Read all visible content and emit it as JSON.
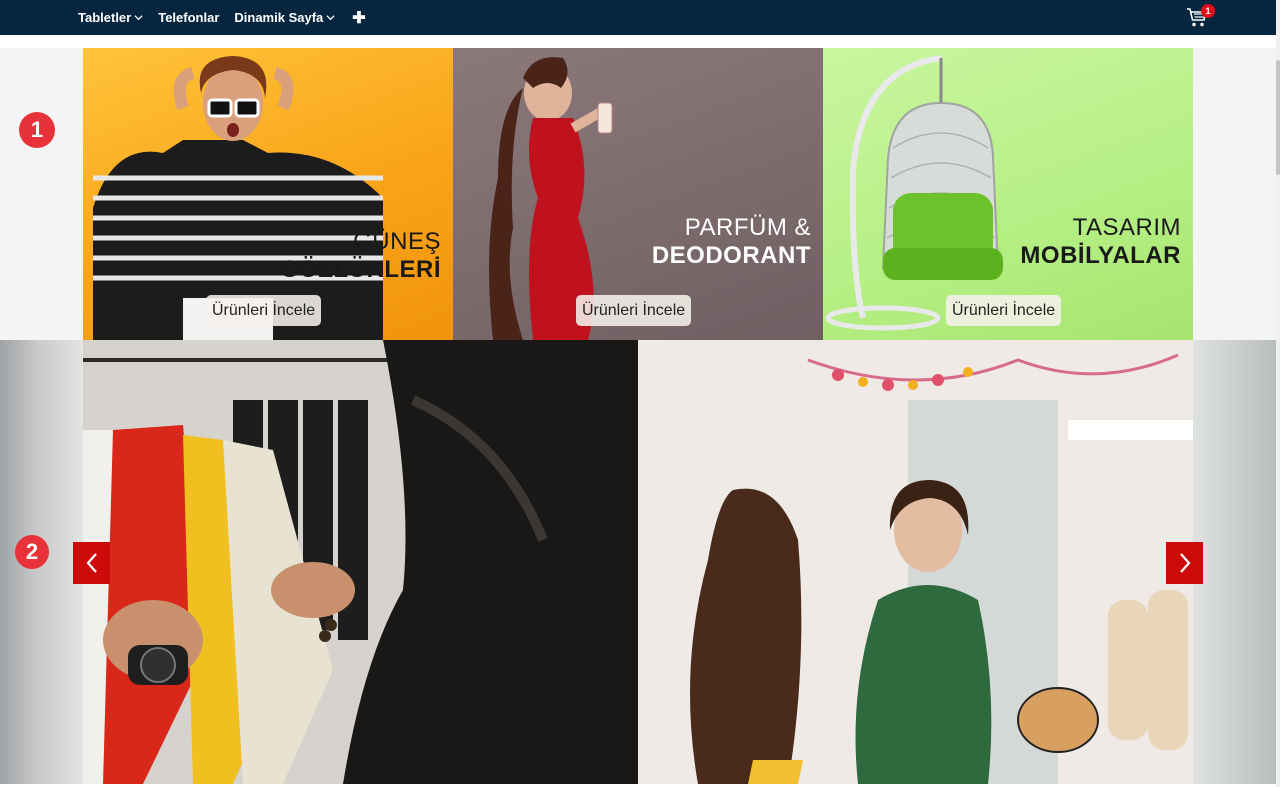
{
  "nav": {
    "items": [
      {
        "label": "Tabletler",
        "has_dropdown": true
      },
      {
        "label": "Telefonlar",
        "has_dropdown": false
      },
      {
        "label": "Dinamik Sayfa",
        "has_dropdown": true
      }
    ],
    "add_icon": "plus-icon",
    "cart_icon": "cart-icon",
    "cart_count": "1"
  },
  "banners": [
    {
      "title_line1": "GÜNEŞ",
      "title_line2": "GÖZLÜKLERİ",
      "button_label": "Ürünleri İncele"
    },
    {
      "title_line1": "PARFÜM &",
      "title_line2": "DEODORANT",
      "button_label": "Ürünleri İncele"
    },
    {
      "title_line1": "TASARIM",
      "title_line2": "MOBİLYALAR",
      "button_label": "Ürünleri İncele"
    }
  ],
  "section_badges": [
    "1",
    "2"
  ],
  "slider": {
    "prev_icon": "chevron-left-icon",
    "next_icon": "chevron-right-icon"
  },
  "colors": {
    "nav_bg": "#062640",
    "accent_red": "#cc0a0a",
    "badge_red": "#e63238",
    "banner_yellow": "#f9a418",
    "banner_mauve": "#7b6a6c",
    "banner_green": "#b5ef84"
  }
}
